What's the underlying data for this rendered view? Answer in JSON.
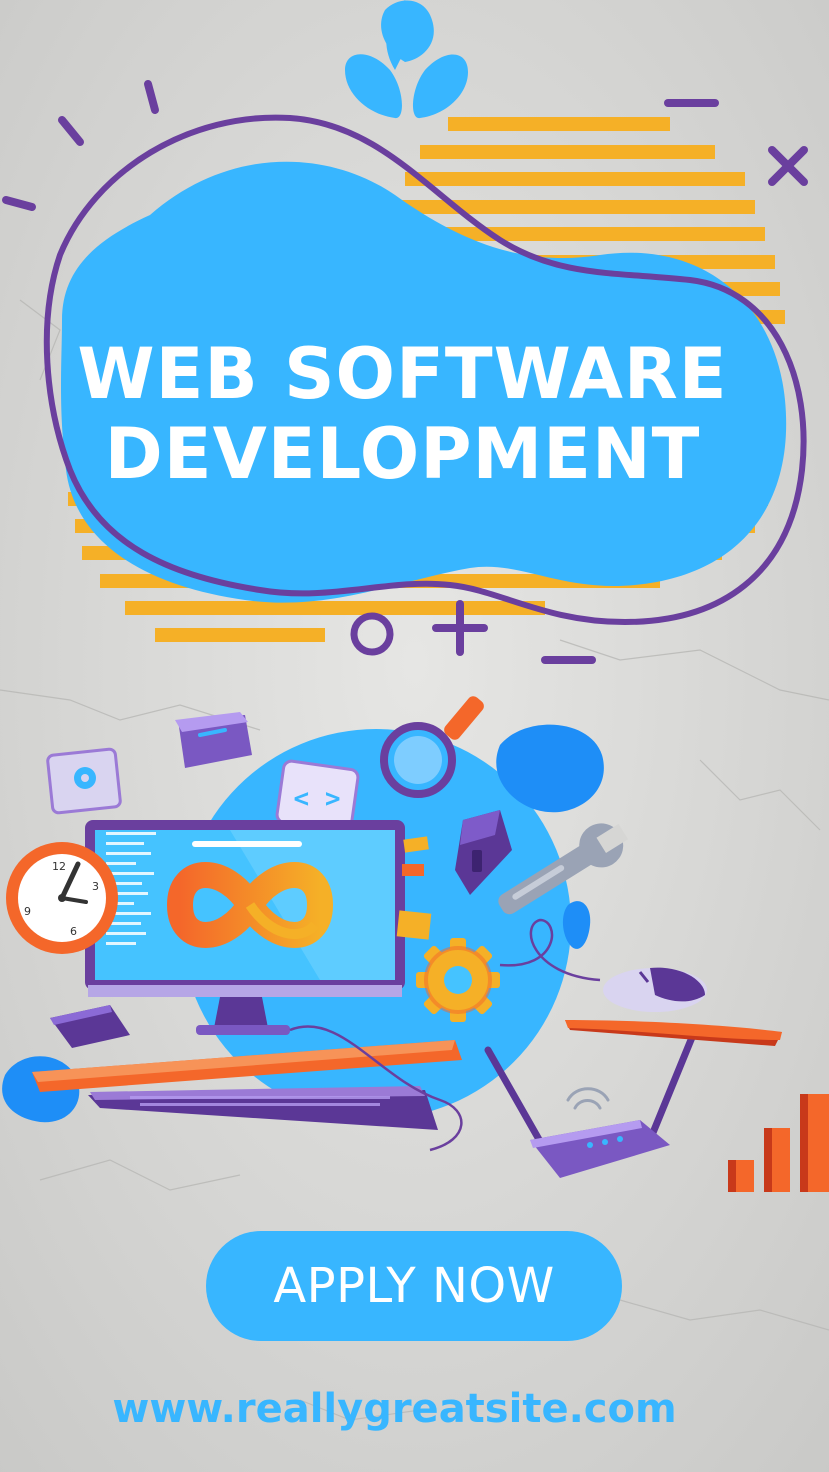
{
  "headline": {
    "line_1": "WEB SOFTWARE",
    "line_2": "DEVELOPMENT"
  },
  "cta": {
    "label": "APPLY NOW"
  },
  "footer": {
    "url": "www.reallygreatsite.com"
  },
  "illustration": {
    "clock_numbers": [
      "12",
      "3",
      "6",
      "9"
    ],
    "code_tile_symbol": "< >"
  },
  "icons": [
    "splash-icon",
    "clock-icon",
    "gear-icon",
    "code-brackets-icon",
    "magnifier-icon",
    "wrench-icon",
    "infinity-icon",
    "mouse-icon",
    "router-icon",
    "bar-chart-icon",
    "keyboard-icon",
    "monitor-icon"
  ],
  "colors": {
    "background": "#d6d6d4",
    "brand_blue": "#38b6ff",
    "deep_blue": "#1e8ef7",
    "purple": "#6a3f9e",
    "purple_light": "#9b7ad6",
    "stripe_yellow": "#f5b027",
    "orange": "#f4672a",
    "white": "#ffffff"
  }
}
